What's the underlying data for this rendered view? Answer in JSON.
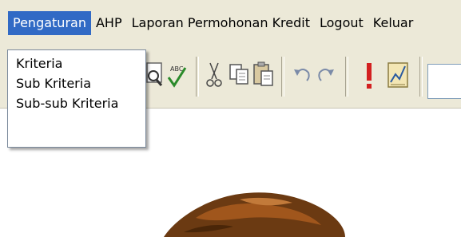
{
  "menubar": {
    "items": [
      {
        "label": "Pengaturan",
        "active": true
      },
      {
        "label": "AHP",
        "active": false
      },
      {
        "label": "Laporan Permohonan Kredit",
        "active": false
      },
      {
        "label": "Logout",
        "active": false
      },
      {
        "label": "Keluar",
        "active": false
      }
    ],
    "active_color": "#316ac5"
  },
  "dropdown": {
    "items": [
      {
        "label": "Kriteria"
      },
      {
        "label": "Sub Kriteria"
      },
      {
        "label": "Sub-sub Kriteria"
      }
    ]
  },
  "toolbar": {
    "buttons": [
      {
        "icon": "print-preview-icon"
      },
      {
        "icon": "spelling-check-icon"
      },
      {
        "icon": "cut-icon"
      },
      {
        "icon": "copy-icon"
      },
      {
        "icon": "paste-icon"
      },
      {
        "icon": "undo-icon"
      },
      {
        "icon": "redo-icon"
      },
      {
        "icon": "exclamation-icon"
      },
      {
        "icon": "chart-icon"
      }
    ]
  },
  "colors": {
    "chrome": "#ece9d8",
    "highlight": "#316ac5",
    "icon_brown": "#6b3a12"
  }
}
